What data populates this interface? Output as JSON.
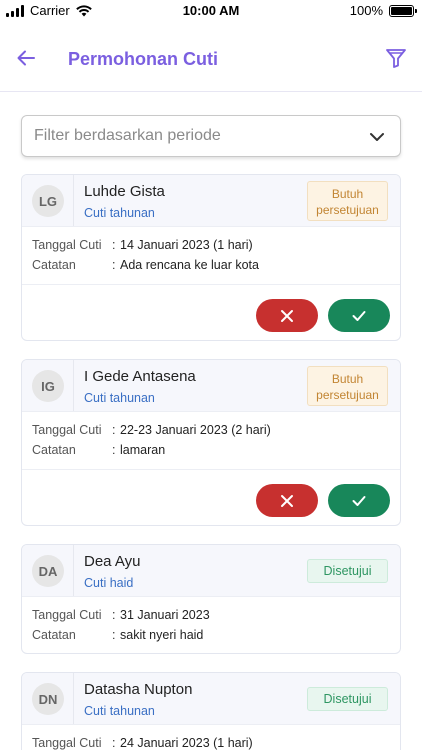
{
  "status_bar": {
    "carrier": "Carrier",
    "time": "10:00 AM",
    "battery": "100%"
  },
  "header": {
    "title": "Permohonan Cuti",
    "back_icon": "arrow-left-icon",
    "filter_icon": "funnel-icon",
    "accent_color": "#7b5fe0"
  },
  "filter": {
    "placeholder": "Filter berdasarkan periode"
  },
  "labels": {
    "date": "Tanggal Cuti",
    "note": "Catatan",
    "separator": ":"
  },
  "requests": [
    {
      "initials": "LG",
      "name": "Luhde Gista",
      "type": "Cuti tahunan",
      "status": "Butuh persetujuan",
      "status_kind": "pending",
      "date": "14 Januari 2023 (1 hari)",
      "note": "Ada rencana ke luar kota",
      "actions": true
    },
    {
      "initials": "IG",
      "name": "I Gede Antasena",
      "type": "Cuti tahunan",
      "status": "Butuh persetujuan",
      "status_kind": "pending",
      "date": "22-23 Januari 2023 (2 hari)",
      "note": "lamaran",
      "actions": true
    },
    {
      "initials": "DA",
      "name": "Dea Ayu",
      "type": "Cuti haid",
      "status": "Disetujui",
      "status_kind": "approved",
      "date": "31 Januari 2023",
      "note": "sakit nyeri haid",
      "actions": false
    },
    {
      "initials": "DN",
      "name": "Datasha Nupton",
      "type": "Cuti tahunan",
      "status": "Disetujui",
      "status_kind": "approved",
      "date": "24 Januari 2023 (1 hari)",
      "note": "",
      "actions": false
    }
  ],
  "colors": {
    "reject": "#c7302f",
    "approve": "#18875a",
    "pending_text": "#c28533",
    "approved_text": "#2e9662"
  }
}
